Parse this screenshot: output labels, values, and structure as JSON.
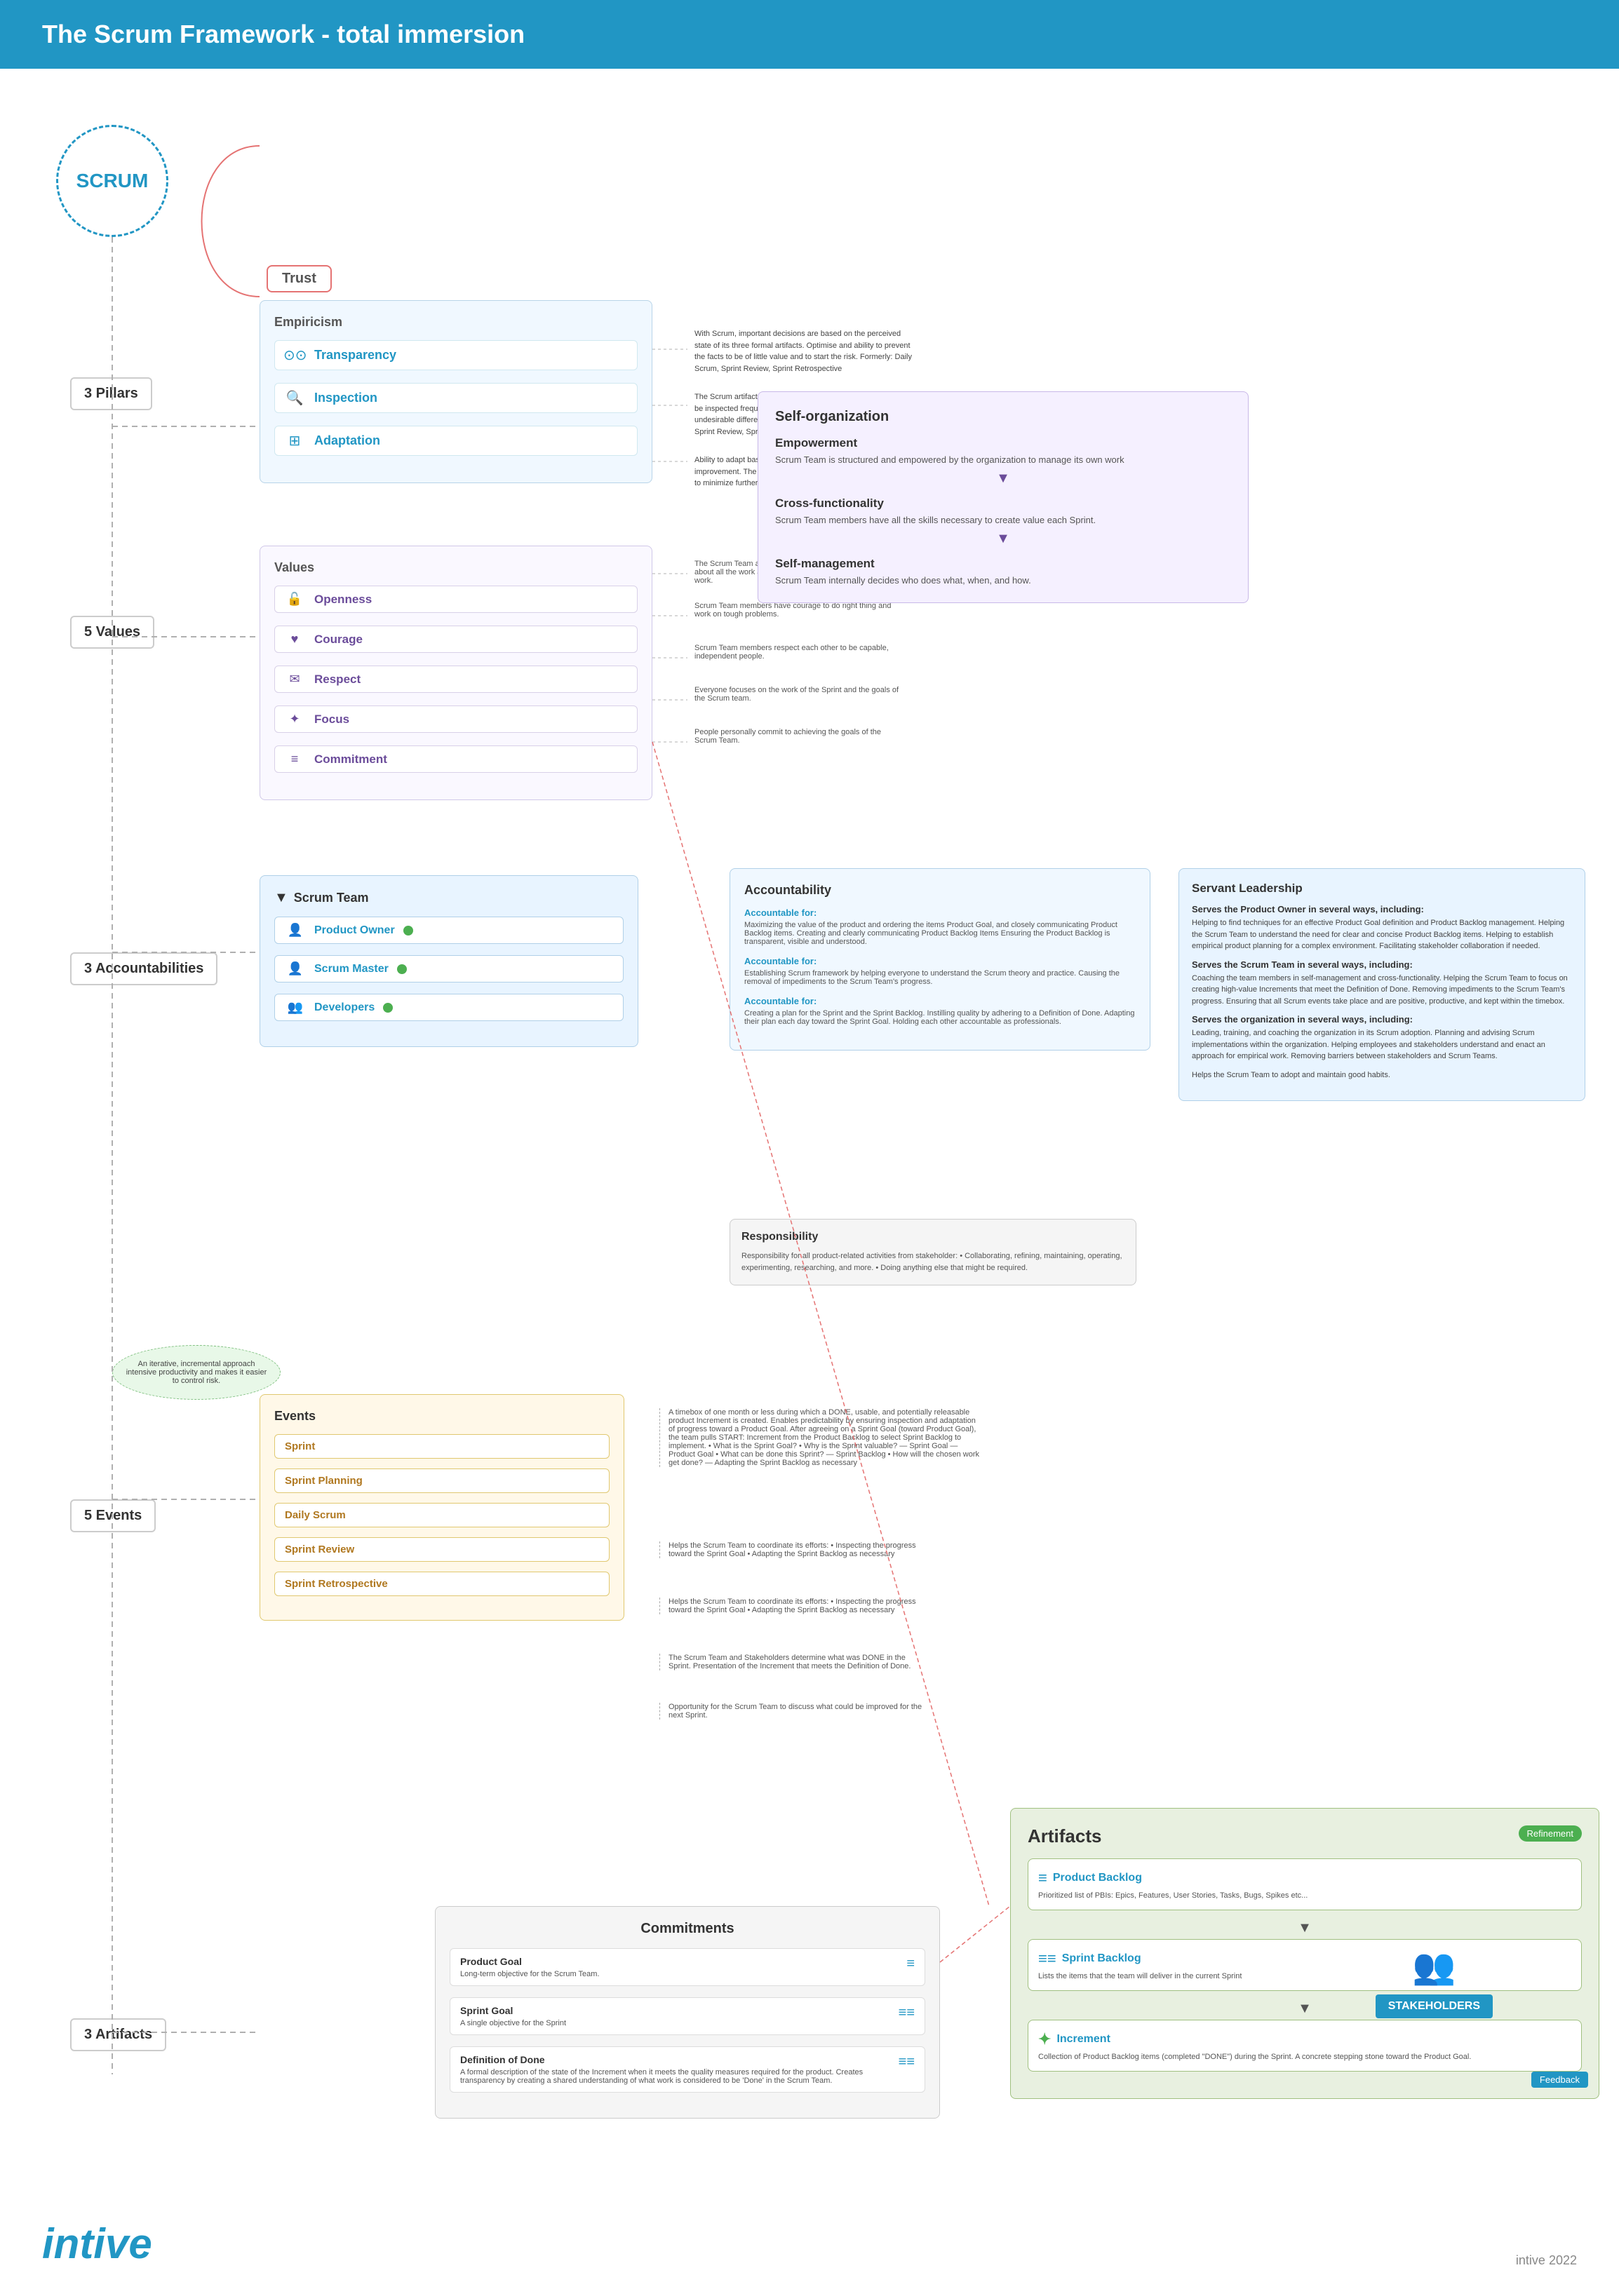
{
  "header": {
    "title": "The Scrum Framework - total immersion",
    "bg": "#2196c4"
  },
  "scrum": {
    "label": "SCRUM"
  },
  "sections": {
    "pillars": "3 Pillars",
    "values": "5 Values",
    "accountabilities": "3 Accountabilities",
    "events": "5 Events",
    "artifacts": "3 Artifacts"
  },
  "trust": {
    "label": "Trust"
  },
  "empiricism": {
    "label": "Empiricism",
    "pillars": [
      {
        "icon": "⊙⊙",
        "name": "Transparency",
        "desc": "With Scrum, important decisions are based on the perceived state of its three formal artifacts. Optimise and ability to prevent the facts to be of little value and to start the risk.\nFormerly: Daily Scrum, Sprint Review, Sprint Retrospective"
      },
      {
        "icon": "🔍",
        "name": "Inspection",
        "desc": "The Scrum artifacts and the progress toward agreed goals must be inspected frequently and diligently to detect potentially undesirable differences or problems.\nFormerly: Daily Scrum, Sprint Review, Sprint Retrospective"
      },
      {
        "icon": "⊞⊞⊞",
        "name": "Adaptation",
        "desc": "Ability to adapt based on the result of the inspection - continuous improvement. The adjustment must be made as soon as possible to minimize further deviation during the Sprint."
      }
    ]
  },
  "values": {
    "label": "Values",
    "items": [
      {
        "icon": "🔓",
        "name": "Openness",
        "desc": "The Scrum Team and its stakeholders agree to be open about all the work and the challenges with performing the work."
      },
      {
        "icon": "♥",
        "name": "Courage",
        "desc": "Scrum Team members have courage to do right thing and work on tough problems."
      },
      {
        "icon": "✉",
        "name": "Respect",
        "desc": "Scrum Team members respect each other to be capable, independent people."
      },
      {
        "icon": "✦",
        "name": "Focus",
        "desc": "Everyone focuses on the work of the Sprint and the goals of the Scrum team."
      },
      {
        "icon": "≡",
        "name": "Commitment",
        "desc": "People personally commit to achieving the goals of the Scrum Team."
      }
    ]
  },
  "selfOrganization": {
    "title": "Self-organization",
    "empowerment": {
      "title": "Empowerment",
      "desc": "Scrum Team is structured and empowered by the organization to manage its own work"
    },
    "crossFunctionality": {
      "title": "Cross-functionality",
      "desc": "Scrum Team members have all the skills necessary to create value each Sprint."
    },
    "selfManagement": {
      "title": "Self-management",
      "desc": "Scrum Team internally decides who does what, when, and how."
    }
  },
  "scrumTeam": {
    "label": "Scrum Team",
    "roles": [
      {
        "icon": "👤",
        "name": "Product Owner"
      },
      {
        "icon": "👤",
        "name": "Scrum Master"
      },
      {
        "icon": "👥",
        "name": "Developers"
      }
    ]
  },
  "accountability": {
    "title": "Accountability",
    "items": [
      {
        "title": "Accountable for:",
        "color": "#2196c4",
        "text": "Maximizing the value of the product and ordering the items Product Goal, and closely communicating Product Backlog items.\nCreating and clearly communicating Product Backlog Items\nEnsuring the Product Backlog is transparent, visible and understood."
      },
      {
        "title": "Accountable for:",
        "color": "#2196c4",
        "text": "Establishing Scrum framework by helping everyone to understand the Scrum theory and practice.\nCausing the removal of impediments to the Scrum Team's progress."
      },
      {
        "title": "Accountable for:",
        "color": "#2196c4",
        "text": "Creating a plan for the Sprint and the Sprint Backlog.\nInstilling quality by adhering to a Definition of Done.\nAdapting their plan each day toward the Sprint Goal.\nHolding each other accountable as professionals."
      }
    ]
  },
  "servantLeadership": {
    "title": "Servant Leadership",
    "serves": [
      {
        "subtitle": "Serves the Product Owner in several ways, including:",
        "text": "Helping to find techniques for an effective Product Goal definition and Product Backlog management.\nHelping the Scrum Team to understand the need for clear and concise Product Backlog items.\nHelping to establish empirical product planning for a complex environment.\nFacilitating stakeholder collaboration if needed."
      },
      {
        "subtitle": "Serves the Scrum Team in several ways, including:",
        "text": "Coaching the team members in self-management and cross-functionality.\nHelping the Scrum Team to focus on creating high-value Increments that meet the Definition of Done.\nRemoving impediments to the Scrum Team's progress.\nEnsuring that all Scrum events take place and are positive, productive, and kept within the timebox."
      },
      {
        "subtitle": "Serves the organization in several ways, including:",
        "text": "Leading, training, and coaching the organization in its Scrum adoption.\nPlanning and advising Scrum implementations within the organization.\nHelping employees and stakeholders understand and enact an approach for empirical work.\nRemoving barriers between stakeholders and Scrum Teams."
      }
    ],
    "habits": "Helps the Scrum Team to adopt and maintain good habits."
  },
  "responsibility": {
    "title": "Responsibility",
    "text": "Responsibility for all product-related activities from stakeholder:\n• Collaborating, refining, maintaining, operating, experimenting, researching, and more.\n• Doing anything else that might be required."
  },
  "iterativeNote": "An iterative, incremental approach intensive productivity and makes it easier to control risk.",
  "events": {
    "label": "Events",
    "items": [
      {
        "name": "Sprint",
        "desc": "A timebox of one month or less during which a DONE, usable, and potentially releasable product Increment is created. Enables predictability by ensuring inspection and adaptation of progress toward a Product Goal.\n\nAfter agreeing on a Sprint Goal (toward Product Goal), the team pulls START: Increment from the Product Backlog to select Sprint Backlog to implement.\n• What is the Sprint Goal?\n• Why is the Sprint valuable? — Sprint Goal — Product Goal\n• What can be done this Sprint? — Sprint Backlog\n• How will the chosen work get done? — Adapting the Sprint Backlog as necessary"
      },
      {
        "name": "Sprint Planning",
        "desc": "Helps the Scrum Team to coordinate its efforts:\n• Inspecting the progress toward the Sprint Goal\n• Adapting the Sprint Backlog as necessary"
      },
      {
        "name": "Daily Scrum",
        "desc": "Helps the Scrum Team to coordinate its efforts:\n• Inspecting the progress toward the Sprint Goal\n• Adapting the Sprint Backlog as necessary"
      },
      {
        "name": "Sprint Review",
        "desc": "The Scrum Team and Stakeholders determine what was DONE in the Sprint.\nPresentation of the Increment that meets the Definition of Done."
      },
      {
        "name": "Sprint Retrospective",
        "desc": "Opportunity for the Scrum Team to discuss what could be improved for the next Sprint."
      }
    ]
  },
  "artifacts": {
    "title": "Artifacts",
    "refinement": "Refinement",
    "feedback": "Feedback",
    "items": [
      {
        "icon": "≡",
        "name": "Product Backlog",
        "color": "#2196c4",
        "desc": "Prioritized list of PBIs: Epics, Features, User Stories, Tasks, Bugs, Spikes etc..."
      },
      {
        "icon": "≡≡",
        "name": "Sprint Backlog",
        "color": "#2196c4",
        "desc": "Lists the items that the team will deliver in the current Sprint"
      },
      {
        "icon": "✦",
        "name": "Increment",
        "color": "#4caf50",
        "desc": "Collection of Product Backlog items (completed \"DONE\") during the Sprint. A concrete stepping stone toward the Product Goal."
      }
    ]
  },
  "commitments": {
    "title": "Commitments",
    "items": [
      {
        "name": "Product Goal",
        "subtext": "Long-term objective for the Scrum Team.",
        "icon": "≡"
      },
      {
        "name": "Sprint Goal",
        "subtext": "A single objective for the Sprint",
        "icon": "≡≡"
      },
      {
        "name": "Definition of Done",
        "subtext": "A formal description of the state of the Increment when it meets the quality measures required for the product.\nCreates transparency by creating a shared understanding of what work is considered to be 'Done' in the Scrum Team.",
        "icon": "≡≡"
      }
    ]
  },
  "stakeholders": {
    "label": "STAKEHOLDERS",
    "icon": "👥"
  },
  "footer": {
    "logo": "intive",
    "year": "intive 2022"
  }
}
